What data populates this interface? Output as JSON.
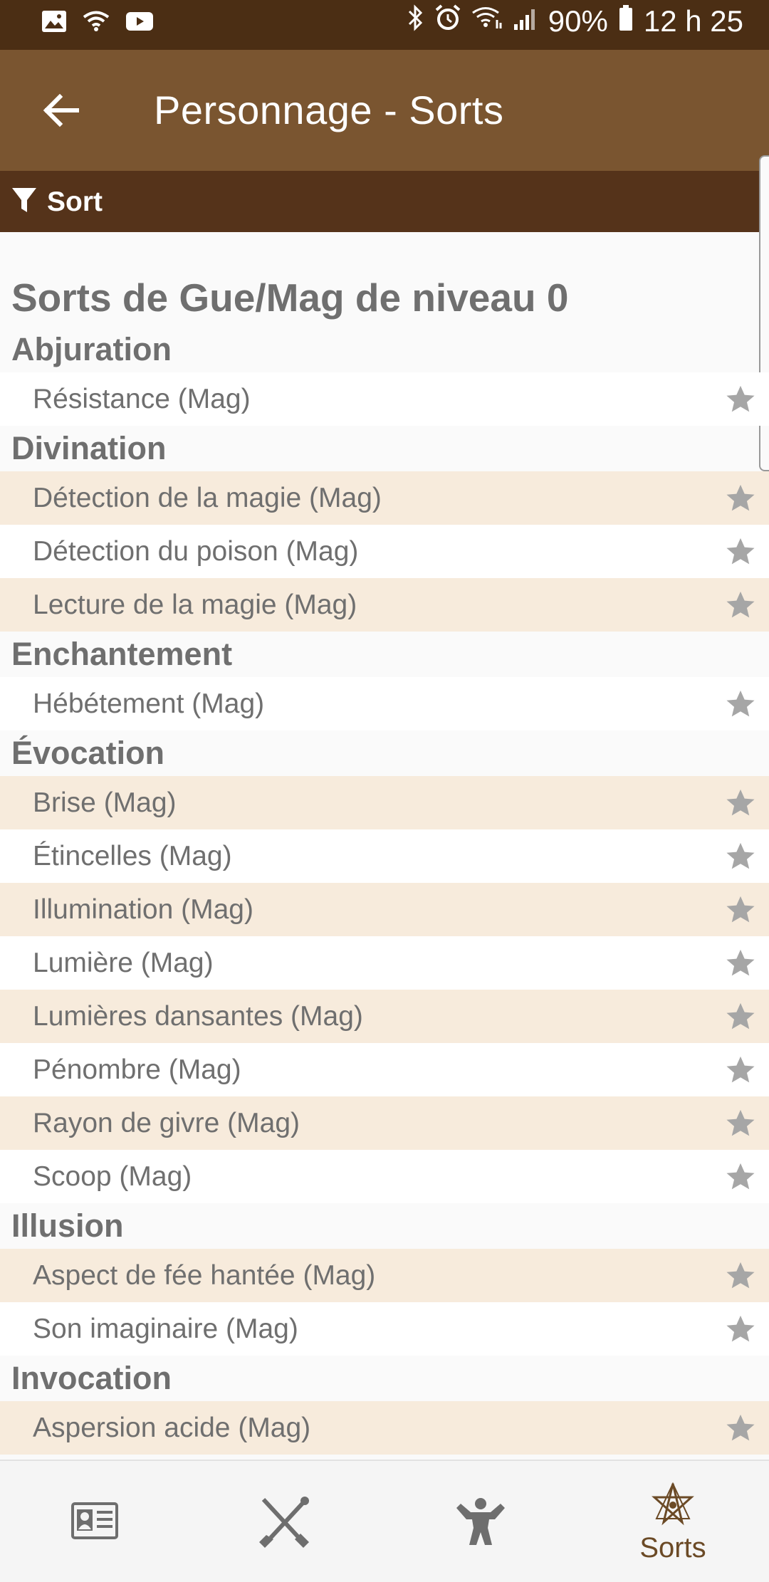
{
  "status_bar": {
    "left_icons": [
      "image-icon",
      "wifi-icon",
      "youtube-icon"
    ],
    "right_icons": [
      "bluetooth-icon",
      "alarm-icon",
      "wifi-icon",
      "signal-icon"
    ],
    "battery": "90%",
    "time": "12 h 25"
  },
  "app_bar": {
    "title": "Personnage - Sorts",
    "back_icon": "arrow-back-icon"
  },
  "filter_bar": {
    "label": "Sort",
    "icon": "filter-icon"
  },
  "content": {
    "title": "Sorts de Gue/Mag de niveau 0",
    "groups": [
      {
        "name": "Abjuration",
        "spells": [
          "Résistance (Mag)"
        ]
      },
      {
        "name": "Divination",
        "spells": [
          "Détection de la magie (Mag)",
          "Détection du poison (Mag)",
          "Lecture de la magie (Mag)"
        ]
      },
      {
        "name": "Enchantement",
        "spells": [
          "Hébétement (Mag)"
        ]
      },
      {
        "name": "Évocation",
        "spells": [
          "Brise (Mag)",
          "Étincelles (Mag)",
          "Illumination (Mag)",
          "Lumière (Mag)",
          "Lumières dansantes (Mag)",
          "Pénombre (Mag)",
          "Rayon de givre (Mag)",
          "Scoop (Mag)"
        ]
      },
      {
        "name": "Illusion",
        "spells": [
          "Aspect de fée hantée (Mag)",
          "Son imaginaire (Mag)"
        ]
      },
      {
        "name": "Invocation",
        "spells": [
          "Aspersion acide (Mag)"
        ]
      }
    ]
  },
  "bottom_nav": {
    "items": [
      {
        "icon": "id-card-icon",
        "label": ""
      },
      {
        "icon": "crossed-weapons-icon",
        "label": ""
      },
      {
        "icon": "strongman-icon",
        "label": ""
      },
      {
        "icon": "heptagram-star-icon",
        "label": "Sorts"
      }
    ]
  },
  "colors": {
    "status_bar": "#4b2e14",
    "app_bar": "#7a5530",
    "filter_bar": "#55331a",
    "row_alt": "#f7ebdc",
    "text": "#6f6f6f",
    "accent": "#6b4a26"
  }
}
